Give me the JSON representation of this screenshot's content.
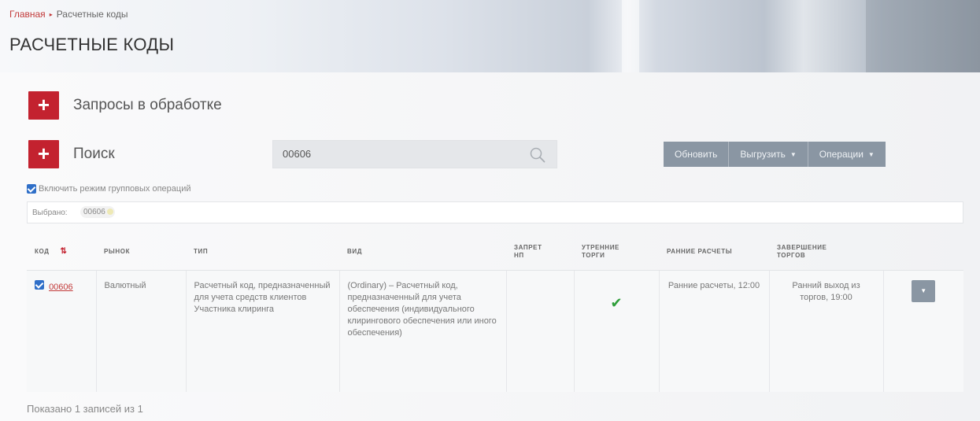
{
  "breadcrumb": {
    "home": "Главная",
    "separator": "▸",
    "current": "Расчетные коды"
  },
  "page_title": "РАСЧЕТНЫЕ КОДЫ",
  "requests_section": {
    "plus": "+",
    "label": "Запросы в обработке"
  },
  "search_section": {
    "plus": "+",
    "label": "Поиск",
    "value": "00606",
    "icon": "search-icon"
  },
  "toolbar": {
    "refresh": "Обновить",
    "export": "Выгрузить",
    "operations": "Операции"
  },
  "group_ops": {
    "checked": true,
    "label": "Включить режим групповых операций"
  },
  "selected": {
    "label": "Выбрано:",
    "tag": "00606"
  },
  "table": {
    "headers": {
      "code": "КОД",
      "market": "РЫНОК",
      "type": "ТИП",
      "kind": "ВИД",
      "ban": "ЗАПРЕТ\nНП",
      "morning": "УТРЕННИЕ\nТОРГИ",
      "early": "РАННИЕ РАСЧЕТЫ",
      "completion": "ЗАВЕРШЕНИЕ\nТОРГОВ"
    },
    "rows": [
      {
        "code": "00606",
        "market": "Валютный",
        "type": "Расчетный код, предназначенный для учета средств клиентов Участника клиринга",
        "kind": "(Ordinary) – Расчетный код, предназначенный для учета обеспечения (индивидуального клирингового обеспечения или иного обеспечения)",
        "ban": "",
        "morning": "✔",
        "early": "Ранние расчеты, 12:00",
        "completion": "Ранний выход из торгов, 19:00"
      }
    ]
  },
  "footer": "Показано 1 записей из 1",
  "colors": {
    "accent": "#c3222f",
    "button": "#8a96a3",
    "check": "#2e9e3a",
    "link": "#c23a3a"
  }
}
